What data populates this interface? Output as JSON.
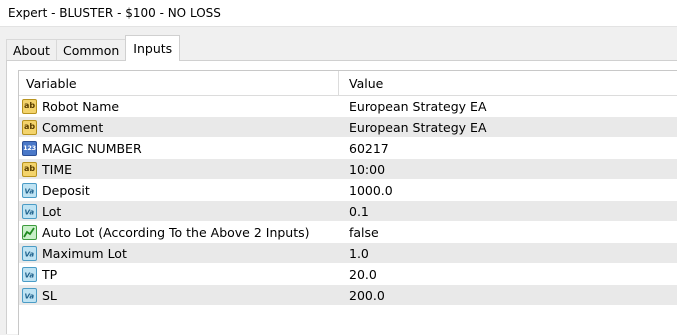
{
  "window": {
    "title": "Expert - BLUSTER - $100 - NO LOSS"
  },
  "tabs": [
    {
      "label": "About",
      "active": false
    },
    {
      "label": "Common",
      "active": false
    },
    {
      "label": "Inputs",
      "active": true
    }
  ],
  "table": {
    "columns": {
      "variable": "Variable",
      "value": "Value"
    },
    "rows": [
      {
        "icon": "string-ab-icon",
        "variable": "Robot Name",
        "value": "European Strategy EA"
      },
      {
        "icon": "string-ab-icon",
        "variable": "Comment",
        "value": "European Strategy EA"
      },
      {
        "icon": "integer-123-icon",
        "variable": "MAGIC NUMBER",
        "value": "60217"
      },
      {
        "icon": "string-ab-icon",
        "variable": "TIME",
        "value": "10:00"
      },
      {
        "icon": "double-value-icon",
        "variable": "Deposit",
        "value": "1000.0"
      },
      {
        "icon": "double-value-icon",
        "variable": "Lot",
        "value": "0.1"
      },
      {
        "icon": "boolean-chart-icon",
        "variable": "Auto Lot (According To the Above 2 Inputs)",
        "value": "false"
      },
      {
        "icon": "double-value-icon",
        "variable": "Maximum Lot",
        "value": "1.0"
      },
      {
        "icon": "double-value-icon",
        "variable": "TP",
        "value": "20.0"
      },
      {
        "icon": "double-value-icon",
        "variable": "SL",
        "value": "200.0"
      }
    ]
  },
  "icon_glyphs": {
    "ab": "ab",
    "num": "123",
    "val": "V",
    "val2": "a"
  }
}
